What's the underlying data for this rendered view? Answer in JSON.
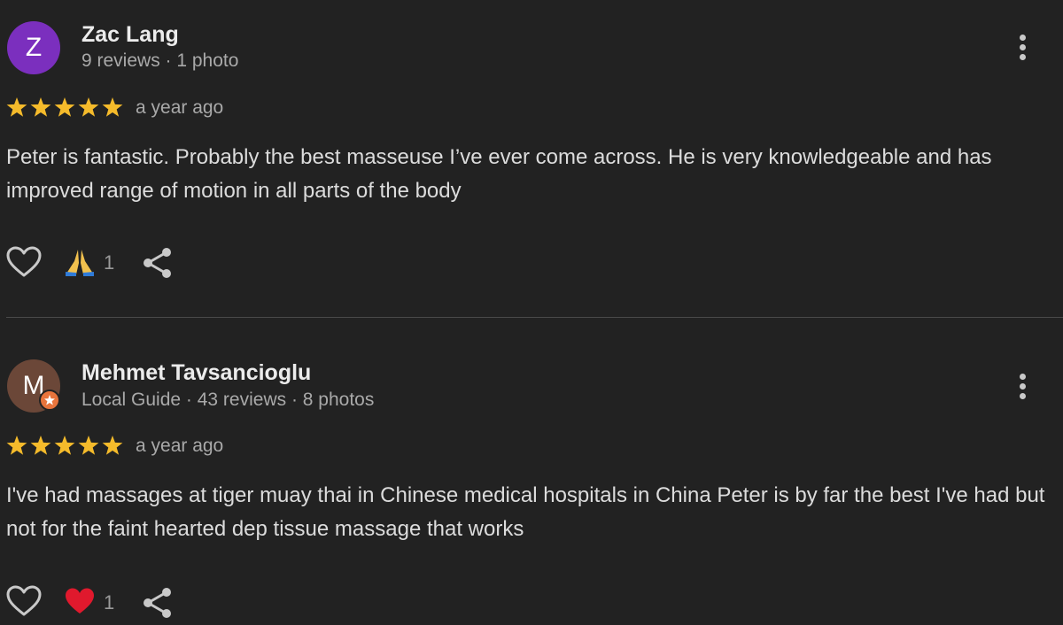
{
  "colors": {
    "background": "#222222",
    "star": "#f5bb2b",
    "avatar_z": "#7b2fbe",
    "avatar_m": "#6b4738",
    "local_guide_badge": "#e8743c",
    "reaction_heart": "#e0192d",
    "reaction_pray": "#f2c14e"
  },
  "reviews": [
    {
      "avatar_letter": "Z",
      "author": "Zac Lang",
      "meta": "9 reviews · 1 photo",
      "rating": 5,
      "date": "a year ago",
      "text": "Peter is fantastic. Probably the best masseuse I’ve ever come across. He is very knowledgeable and has improved range of motion in all parts of the body",
      "reaction_icon": "folded-hands-emoji",
      "reaction_count": "1"
    },
    {
      "avatar_letter": "M",
      "author": "Mehmet Tavsancioglu",
      "meta": "Local Guide · 43 reviews · 8 photos",
      "rating": 5,
      "date": "a year ago",
      "text": "I've had massages at tiger muay thai in Chinese medical hospitals in China Peter is by far the best I've had but not for the faint hearted dep tissue massage that works",
      "reaction_icon": "red-heart-emoji",
      "reaction_count": "1"
    }
  ],
  "icons": {
    "like": "heart-outline-icon",
    "share": "share-icon",
    "more": "more-vertical-icon",
    "local_guide": "local-guide-star-badge"
  }
}
